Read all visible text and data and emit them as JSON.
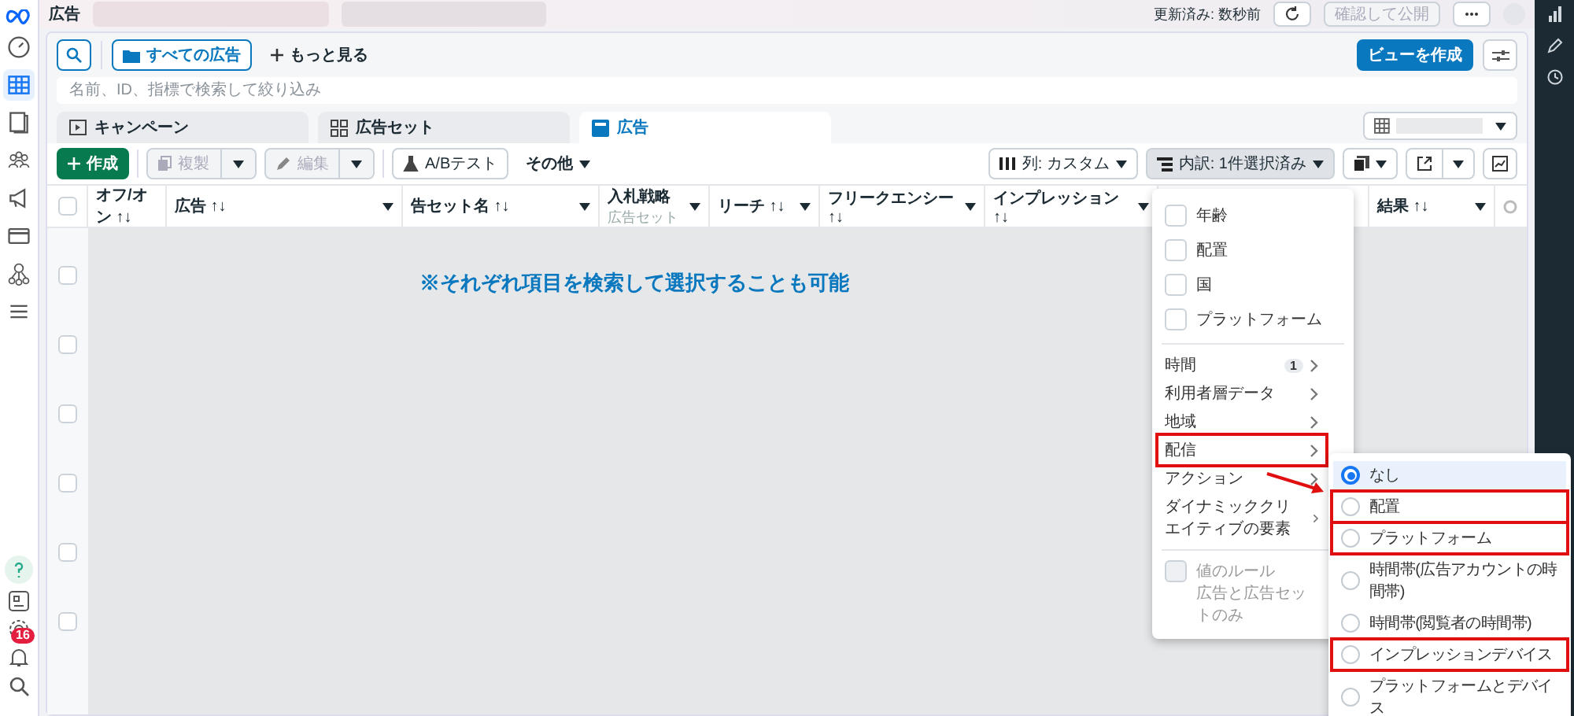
{
  "sidebar": {
    "items": [
      {
        "selected": false
      },
      {
        "selected": true
      },
      {
        "selected": false
      },
      {
        "selected": false
      },
      {
        "selected": false
      },
      {
        "selected": false
      },
      {
        "selected": false
      },
      {
        "selected": false
      }
    ],
    "notification_count": "16"
  },
  "header": {
    "title": "広告",
    "status": "更新済み: 数秒前",
    "publish_button": {
      "label": "確認して公開",
      "disabled": true
    }
  },
  "filter_bar": {
    "all_ads_button": "すべての広告",
    "more_button": "もっと見る",
    "create_view_button": "ビューを作成"
  },
  "search": {
    "placeholder": "名前、ID、指標で検索して絞り込み"
  },
  "tabs": [
    {
      "label": "キャンペーン",
      "selected": false
    },
    {
      "label": "広告セット",
      "selected": false
    },
    {
      "label": "広告",
      "selected": true
    }
  ],
  "toolbar": {
    "create_button": "作成",
    "buttons": [
      {
        "label": "複製",
        "disabled": true
      },
      {
        "label": "編集",
        "disabled": true
      }
    ],
    "ab_test_button": "A/Bテスト",
    "other_button": "その他",
    "columns_button": "列: カスタム",
    "breakdown_button": {
      "label": "内訳: 1件選択済み",
      "pressed": true
    }
  },
  "table": {
    "columns": [
      {
        "label": "オフ/オン ↑↓"
      },
      {
        "label": "広告 ↑↓"
      },
      {
        "label": "告セット名 ↑↓"
      },
      {
        "label": "入札戦略",
        "sublabel": "広告セット"
      },
      {
        "label": "リーチ ↑↓"
      },
      {
        "label": "フリークエンシー ↑↓"
      },
      {
        "label": "インプレッション ↑↓"
      },
      {
        "label": "結果 ↑↓"
      }
    ],
    "select_all_checked": false,
    "rows": [
      {
        "checked": false
      },
      {
        "checked": false
      },
      {
        "checked": false
      },
      {
        "checked": false
      },
      {
        "checked": false
      },
      {
        "checked": false
      }
    ]
  },
  "annotation": "※それぞれ項目を検索して選択することも可能",
  "breakdown_menu": {
    "checkbox_items": [
      {
        "label": "年齢",
        "checked": false
      },
      {
        "label": "配置",
        "checked": false
      },
      {
        "label": "国",
        "checked": false
      },
      {
        "label": "プラットフォーム",
        "checked": false
      }
    ],
    "categories": [
      {
        "label": "時間",
        "count": "1",
        "highlighted": false
      },
      {
        "label": "利用者層データ",
        "highlighted": false
      },
      {
        "label": "地域",
        "highlighted": false
      },
      {
        "label": "配信",
        "highlighted": true
      },
      {
        "label": "アクション",
        "highlighted": false
      },
      {
        "label": "ダイナミッククリエイティブの要素",
        "highlighted": false
      }
    ],
    "value_rule": {
      "label": "値のルール",
      "note": "広告と広告セットのみ",
      "disabled": true
    }
  },
  "delivery_submenu": {
    "options": [
      {
        "label": "なし",
        "selected": true,
        "highlighted": false
      },
      {
        "label": "配置",
        "selected": false,
        "highlighted": true
      },
      {
        "label": "プラットフォーム",
        "selected": false,
        "highlighted": true
      },
      {
        "label": "時間帯(広告アカウントの時間帯)",
        "selected": false,
        "highlighted": false
      },
      {
        "label": "時間帯(閲覧者の時間帯)",
        "selected": false,
        "highlighted": false
      },
      {
        "label": "インプレッションデバイス",
        "selected": false,
        "highlighted": true
      },
      {
        "label": "プラットフォームとデバイス",
        "selected": false,
        "highlighted": false
      }
    ]
  }
}
